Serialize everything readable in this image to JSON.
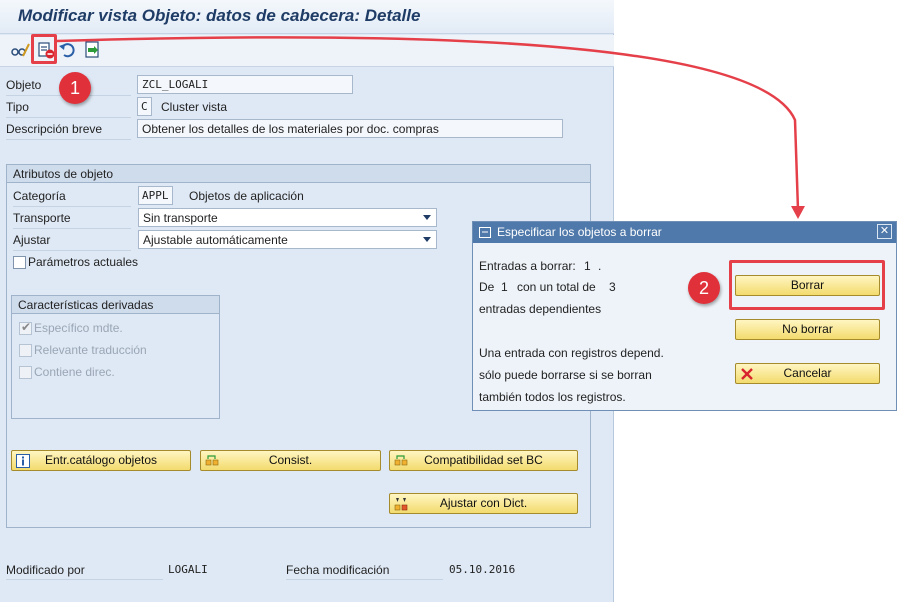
{
  "window": {
    "title": "Modificar vista Objeto: datos de cabecera: Detalle"
  },
  "toolbar": {
    "icons": [
      "display-change-icon",
      "delete-object-icon",
      "undo-icon",
      "transport-icon"
    ]
  },
  "annotations": {
    "step1": "1",
    "step2": "2",
    "highlight_color": "#e5404a"
  },
  "header_fields": {
    "objeto_label": "Objeto",
    "objeto_value": "ZCL_LOGALI",
    "tipo_label": "Tipo",
    "tipo_value": "C",
    "tipo_text": "Cluster vista",
    "descripcion_label": "Descripción breve",
    "descripcion_value": "Obtener los detalles de los materiales por doc. compras"
  },
  "atributos": {
    "header": "Atributos de objeto",
    "categoria_label": "Categoría",
    "categoria_value": "APPL",
    "categoria_text": "Objetos de aplicación",
    "transporte_label": "Transporte",
    "transporte_value": "Sin transporte",
    "ajustar_label": "Ajustar",
    "ajustar_value": "Ajustable automáticamente",
    "parametros_label": "Parámetros actuales"
  },
  "derivadas": {
    "header": "Características derivadas",
    "especifico_label": "Específico mdte.",
    "especifico_checked": true,
    "relevante_label": "Relevante traducción",
    "contiene_label": "Contiene direc."
  },
  "buttons": {
    "catalogo": "Entr.catálogo objetos",
    "consist": "Consist.",
    "compat": "Compatibilidad set BC",
    "ajustar_dict": "Ajustar con Dict."
  },
  "footer": {
    "modificado_label": "Modificado por",
    "modificado_value": "LOGALI",
    "fecha_label": "Fecha modificación",
    "fecha_value": "05.10.2016"
  },
  "dialog": {
    "title": "Especificar los objetos a borrar",
    "line1_prefix": "Entradas a borrar:",
    "line1_value": "1",
    "line1_suffix": ".",
    "line2_prefix": "De",
    "line2_value": "1",
    "line2_mid": "con un total de",
    "line2_total": "3",
    "line3": "entradas dependientes",
    "line4": "Una entrada con registros depend.",
    "line5": "sólo puede borrarse si se borran",
    "line6": "también todos los registros.",
    "borrar_label": "Borrar",
    "no_borrar_label": "No borrar",
    "cancelar_label": "Cancelar",
    "close_symbol": "✕"
  }
}
